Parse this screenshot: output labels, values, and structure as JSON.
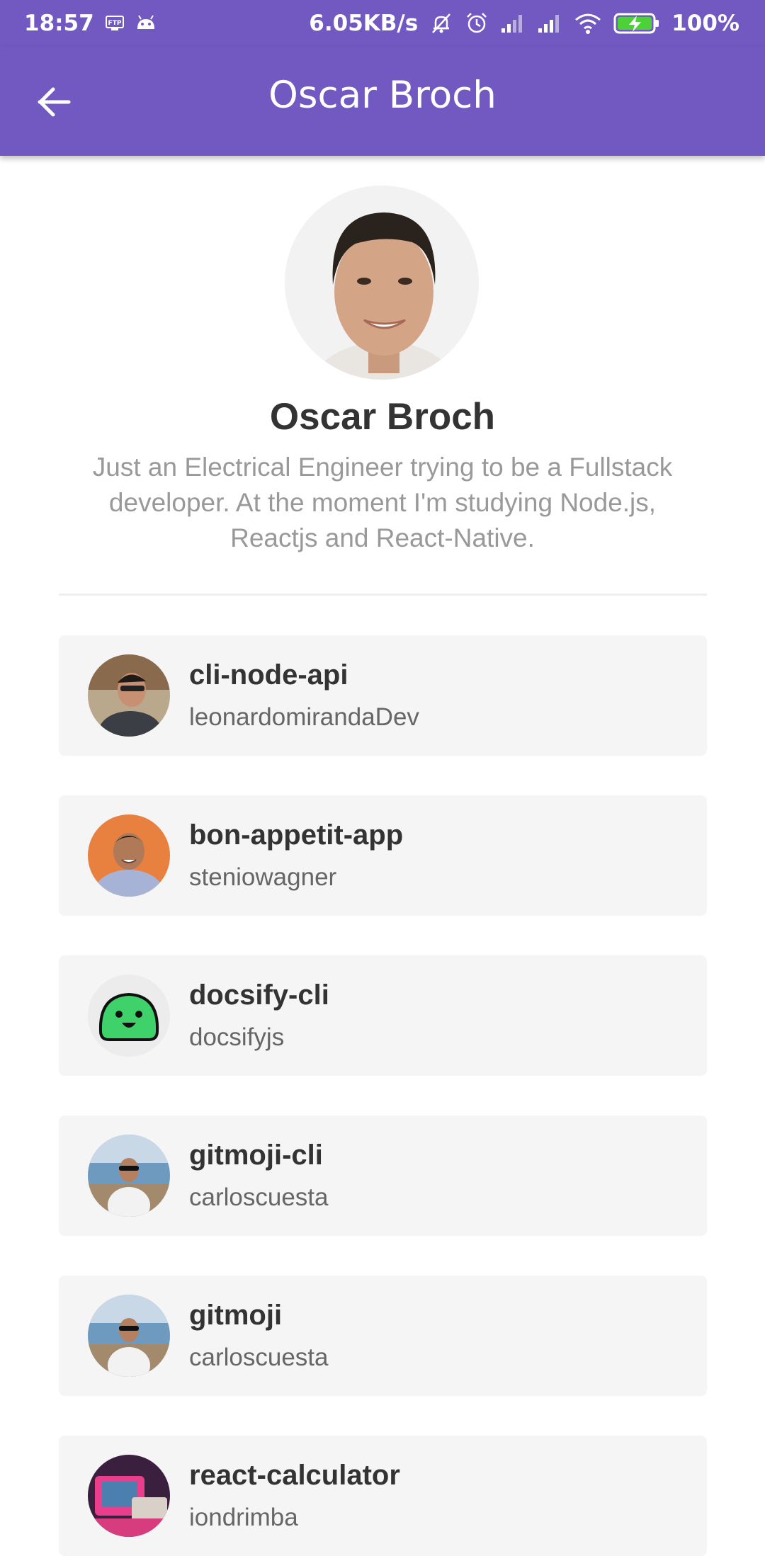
{
  "status_bar": {
    "time": "18:57",
    "network_speed": "6.05KB/s",
    "battery": "100%",
    "icons": [
      "ftp-icon",
      "android-debug-icon",
      "mute-icon",
      "alarm-icon",
      "signal-icon",
      "signal-icon",
      "wifi-icon",
      "battery-charging-icon"
    ]
  },
  "app_bar": {
    "title": "Oscar Broch",
    "back_icon": "arrow-left-icon",
    "color": "#7159c1"
  },
  "profile": {
    "name": "Oscar Broch",
    "bio": "Just an Electrical Engineer trying to be a Fullstack developer. At the moment I'm studying Node.js, Reactjs and React-Native."
  },
  "repositories": [
    {
      "name": "cli-node-api",
      "owner": "leonardomirandaDev"
    },
    {
      "name": "bon-appetit-app",
      "owner": "steniowagner"
    },
    {
      "name": "docsify-cli",
      "owner": "docsifyjs"
    },
    {
      "name": "gitmoji-cli",
      "owner": "carloscuesta"
    },
    {
      "name": "gitmoji",
      "owner": "carloscuesta"
    },
    {
      "name": "react-calculator",
      "owner": "iondrimba"
    }
  ]
}
